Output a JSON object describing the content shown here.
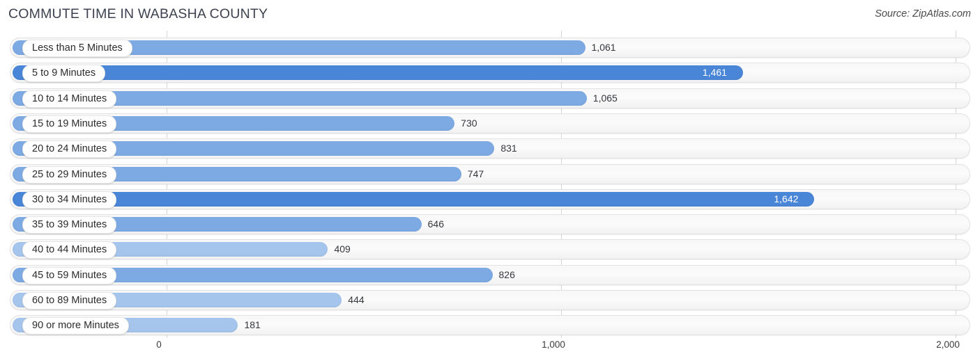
{
  "header": {
    "title": "COMMUTE TIME IN WABASHA COUNTY",
    "source": "Source: ZipAtlas.com"
  },
  "colors": {
    "bar_default": "#7eaae4",
    "bar_dark": "#4a86d8",
    "bar_light": "#a6c5ec",
    "track": "#f7f7f7",
    "gridline": "#d6d6d6",
    "title_text": "#3c4250"
  },
  "chart_data": {
    "type": "bar",
    "orientation": "horizontal",
    "title": "COMMUTE TIME IN WABASHA COUNTY",
    "xlabel": "",
    "ylabel": "",
    "xlim": [
      0,
      2000
    ],
    "grid": true,
    "legend": false,
    "ticks": [
      "0",
      "1,000",
      "2,000"
    ],
    "tick_values": [
      0,
      1000,
      2000
    ],
    "categories": [
      "Less than 5 Minutes",
      "5 to 9 Minutes",
      "10 to 14 Minutes",
      "15 to 19 Minutes",
      "20 to 24 Minutes",
      "25 to 29 Minutes",
      "30 to 34 Minutes",
      "35 to 39 Minutes",
      "40 to 44 Minutes",
      "45 to 59 Minutes",
      "60 to 89 Minutes",
      "90 or more Minutes"
    ],
    "values": [
      1061,
      1461,
      1065,
      730,
      831,
      747,
      1642,
      646,
      409,
      826,
      444,
      181
    ],
    "value_labels": [
      "1,061",
      "1,461",
      "1,065",
      "730",
      "831",
      "747",
      "1,642",
      "646",
      "409",
      "826",
      "444",
      "181"
    ],
    "rows": [
      {
        "label": "Less than 5 Minutes",
        "value": 1061,
        "value_label": "1,061",
        "shade": "mid",
        "label_inside": false
      },
      {
        "label": "5 to 9 Minutes",
        "value": 1461,
        "value_label": "1,461",
        "shade": "dark",
        "label_inside": true
      },
      {
        "label": "10 to 14 Minutes",
        "value": 1065,
        "value_label": "1,065",
        "shade": "mid",
        "label_inside": false
      },
      {
        "label": "15 to 19 Minutes",
        "value": 730,
        "value_label": "730",
        "shade": "mid",
        "label_inside": false
      },
      {
        "label": "20 to 24 Minutes",
        "value": 831,
        "value_label": "831",
        "shade": "mid",
        "label_inside": false
      },
      {
        "label": "25 to 29 Minutes",
        "value": 747,
        "value_label": "747",
        "shade": "mid",
        "label_inside": false
      },
      {
        "label": "30 to 34 Minutes",
        "value": 1642,
        "value_label": "1,642",
        "shade": "dark",
        "label_inside": true
      },
      {
        "label": "35 to 39 Minutes",
        "value": 646,
        "value_label": "646",
        "shade": "mid",
        "label_inside": false
      },
      {
        "label": "40 to 44 Minutes",
        "value": 409,
        "value_label": "409",
        "shade": "light",
        "label_inside": false
      },
      {
        "label": "45 to 59 Minutes",
        "value": 826,
        "value_label": "826",
        "shade": "mid",
        "label_inside": false
      },
      {
        "label": "60 to 89 Minutes",
        "value": 444,
        "value_label": "444",
        "shade": "light",
        "label_inside": false
      },
      {
        "label": "90 or more Minutes",
        "value": 181,
        "value_label": "181",
        "shade": "light",
        "label_inside": false
      }
    ]
  }
}
